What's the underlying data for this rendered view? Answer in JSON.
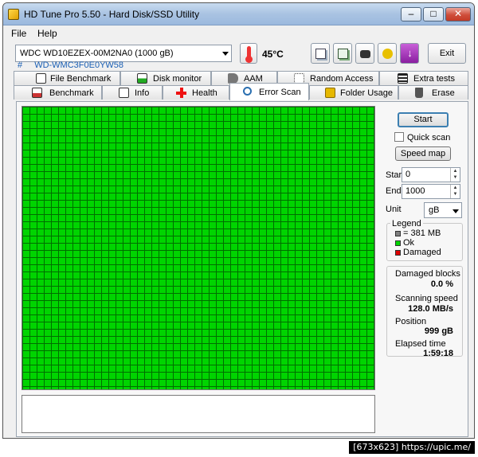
{
  "window": {
    "title": "HD Tune Pro 5.50 - Hard Disk/SSD Utility",
    "minimize": "–",
    "maximize": "□",
    "close": "✕"
  },
  "menu": {
    "file": "File",
    "help": "Help"
  },
  "drive": {
    "selected": "WDC WD10EZEX-00M2NA0 (1000 gB)",
    "hash": "#",
    "serial": "WD-WMC3F0E0YW58"
  },
  "temperature": {
    "value": "45°C",
    "icon": "thermometer-icon"
  },
  "toolbar": {
    "icons": [
      "copy-info-icon",
      "copy-text-icon",
      "camera-icon",
      "options-icon",
      "save-icon"
    ],
    "exit_label": "Exit"
  },
  "tabs_row1": [
    {
      "label": "File Benchmark",
      "icon": "file-benchmark-icon"
    },
    {
      "label": "Disk monitor",
      "icon": "disk-monitor-icon"
    },
    {
      "label": "AAM",
      "icon": "speaker-icon"
    },
    {
      "label": "Random Access",
      "icon": "random-access-icon"
    },
    {
      "label": "Extra tests",
      "icon": "extra-tests-icon"
    }
  ],
  "tabs_row2": [
    {
      "label": "Benchmark",
      "icon": "benchmark-icon"
    },
    {
      "label": "Info",
      "icon": "info-icon"
    },
    {
      "label": "Health",
      "icon": "health-cross-icon"
    },
    {
      "label": "Error Scan",
      "icon": "magnifier-icon",
      "active": true
    },
    {
      "label": "Folder Usage",
      "icon": "folder-icon"
    },
    {
      "label": "Erase",
      "icon": "trash-icon"
    }
  ],
  "controls": {
    "start_label": "Start",
    "quick_scan_label": "Quick scan",
    "quick_scan_checked": false,
    "speed_map_label": "Speed map",
    "start_field_label": "Start",
    "start_value": "0",
    "end_field_label": "End",
    "end_value": "1000",
    "unit_label": "Unit",
    "unit_value": "gB"
  },
  "legend": {
    "title": "Legend",
    "items": [
      {
        "label": "= 381 MB",
        "color": "#808080"
      },
      {
        "label": "Ok",
        "color": "#00d400"
      },
      {
        "label": "Damaged",
        "color": "#e00000"
      }
    ]
  },
  "stats": {
    "damaged_blocks_label": "Damaged blocks",
    "damaged_blocks_value": "0.0 %",
    "scanning_speed_label": "Scanning speed",
    "scanning_speed_value": "128.0 MB/s",
    "position_label": "Position",
    "position_value": "999 gB",
    "elapsed_label": "Elapsed time",
    "elapsed_value": "1:59:18"
  },
  "scan_map": {
    "status": "ok",
    "ok_color": "#00d400"
  },
  "watermark": "[673x623] https://upic.me/"
}
